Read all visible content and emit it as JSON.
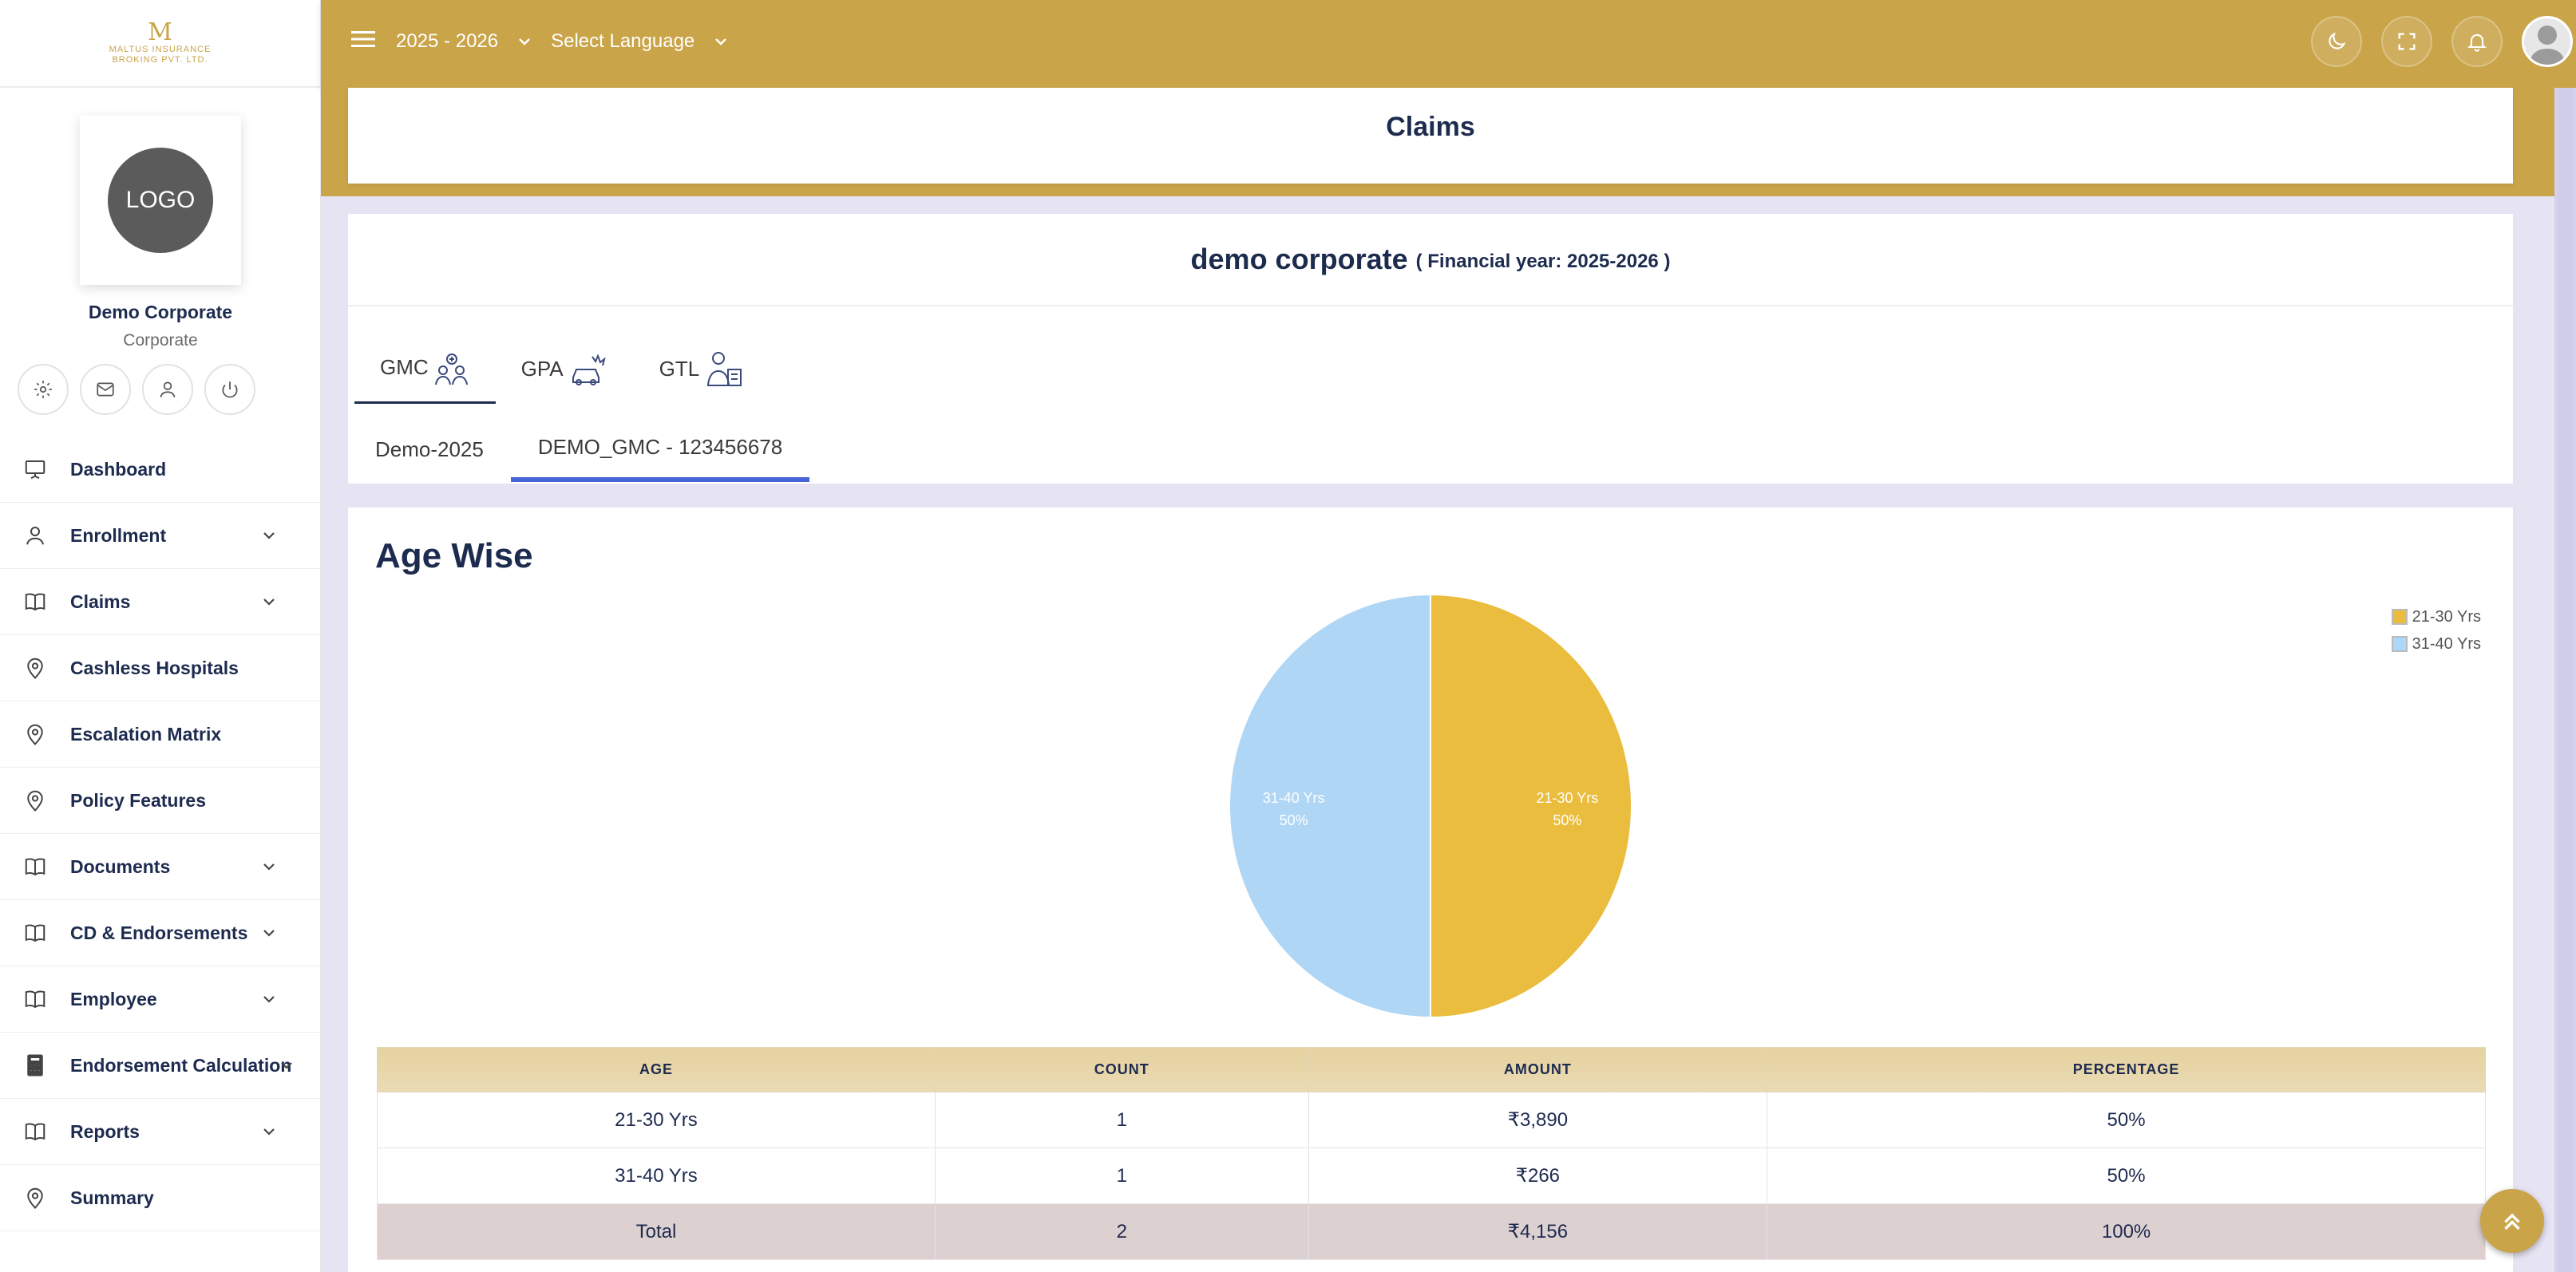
{
  "brand": {
    "mark": "M",
    "line1": "MALTUS INSURANCE",
    "line2": "BROKING PVT. LTD."
  },
  "profile": {
    "logo_text": "LOGO",
    "name": "Demo Corporate",
    "type": "Corporate"
  },
  "quick_actions": [
    {
      "icon": "gear-icon"
    },
    {
      "icon": "mail-icon"
    },
    {
      "icon": "user-icon"
    },
    {
      "icon": "power-icon"
    }
  ],
  "sidebar": {
    "items": [
      {
        "label": "Dashboard",
        "icon": "presentation-icon",
        "has_sub": false
      },
      {
        "label": "Enrollment",
        "icon": "user-icon",
        "has_sub": true
      },
      {
        "label": "Claims",
        "icon": "book-icon",
        "has_sub": true
      },
      {
        "label": "Cashless Hospitals",
        "icon": "location-pin-icon",
        "has_sub": false
      },
      {
        "label": "Escalation Matrix",
        "icon": "location-pin-icon",
        "has_sub": false
      },
      {
        "label": "Policy Features",
        "icon": "location-pin-icon",
        "has_sub": false
      },
      {
        "label": "Documents",
        "icon": "book-icon",
        "has_sub": true
      },
      {
        "label": "CD & Endorsements",
        "icon": "book-icon",
        "has_sub": true
      },
      {
        "label": "Employee",
        "icon": "book-icon",
        "has_sub": true
      },
      {
        "label": "Endorsement Calculation",
        "icon": "calculator-icon",
        "has_sub": true
      },
      {
        "label": "Reports",
        "icon": "book-icon",
        "has_sub": true
      },
      {
        "label": "Summary",
        "icon": "location-pin-icon",
        "has_sub": false
      }
    ]
  },
  "topbar": {
    "year": "2025 - 2026",
    "language": "Select Language"
  },
  "page": {
    "title": "Claims"
  },
  "company": {
    "name": "demo corporate",
    "financial_year": "( Financial year: 2025-2026 )"
  },
  "policy_tabs": [
    {
      "label": "GMC",
      "active": true
    },
    {
      "label": "GPA",
      "active": false
    },
    {
      "label": "GTL",
      "active": false
    }
  ],
  "sub_tabs": [
    {
      "label": "Demo-2025",
      "active": false
    },
    {
      "label": "DEMO_GMC - 123456678",
      "active": true
    }
  ],
  "section": {
    "title": "Age Wise"
  },
  "colors": {
    "gold": "#c9a449",
    "slice1": "#ebbd3e",
    "slice2": "#afd6f5"
  },
  "chart_data": {
    "type": "pie",
    "title": "",
    "categories": [
      "21-30 Yrs",
      "31-40 Yrs"
    ],
    "values": [
      50,
      50
    ],
    "slice_labels": [
      "50%",
      "50%"
    ],
    "legend_position": "top-right"
  },
  "table": {
    "headers": [
      "AGE",
      "COUNT",
      "AMOUNT",
      "PERCENTAGE"
    ],
    "rows": [
      [
        "21-30 Yrs",
        "1",
        "₹3,890",
        "50%"
      ],
      [
        "31-40 Yrs",
        "1",
        "₹266",
        "50%"
      ]
    ],
    "total": [
      "Total",
      "2",
      "₹4,156",
      "100%"
    ]
  }
}
